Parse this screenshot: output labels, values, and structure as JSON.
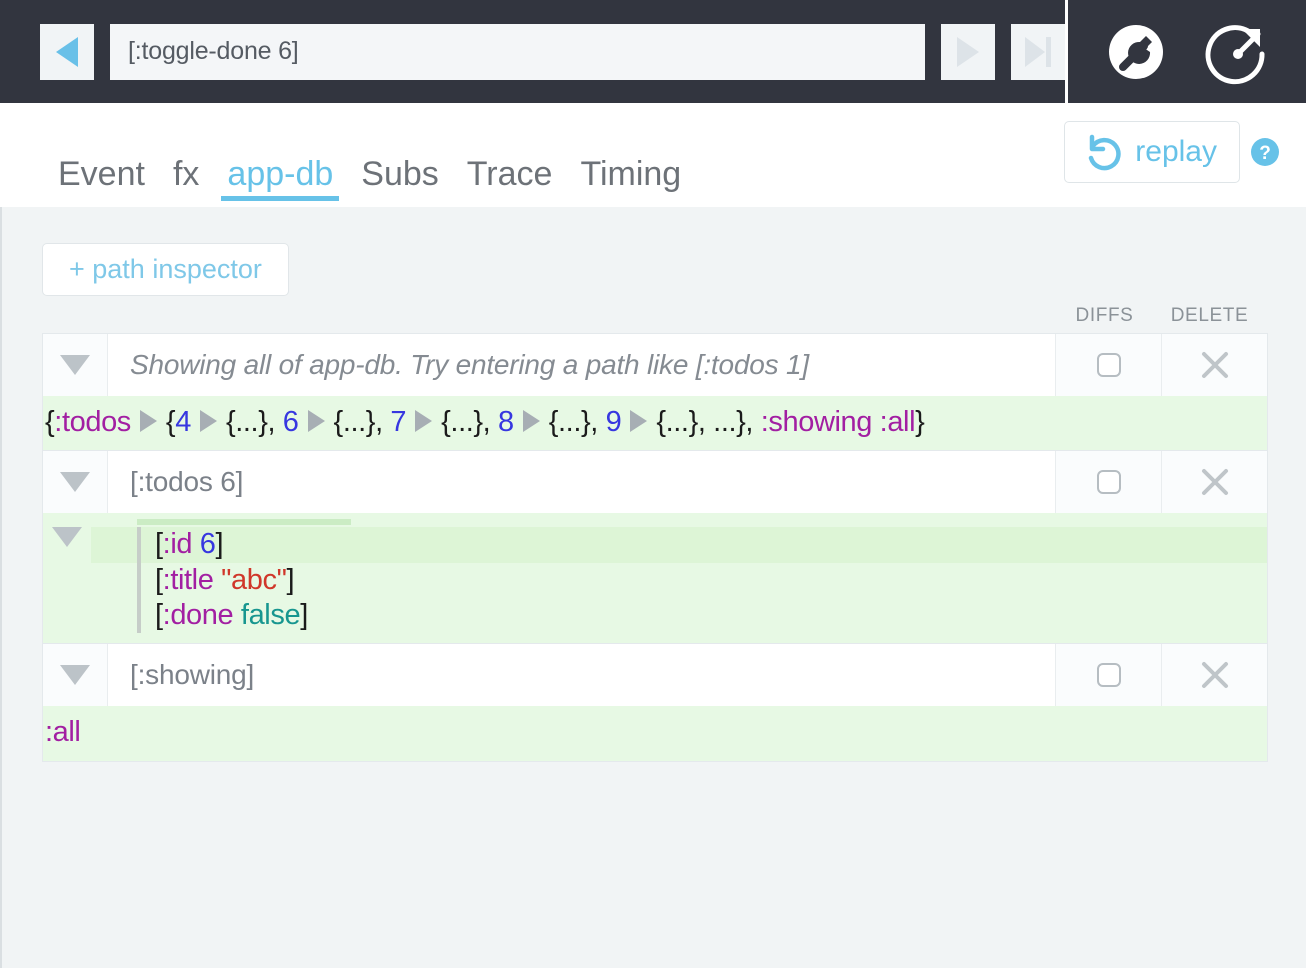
{
  "toolbar": {
    "back_button": "step-back",
    "event_value": "[:toggle-done 6]",
    "event_placeholder": "event",
    "play_button": "play",
    "skip_end_button": "skip-to-end",
    "settings_button": "settings",
    "popout_button": "pop-out"
  },
  "tabs": [
    {
      "label": "Event",
      "active": false
    },
    {
      "label": "fx",
      "active": false
    },
    {
      "label": "app-db",
      "active": true
    },
    {
      "label": "Subs",
      "active": false
    },
    {
      "label": "Trace",
      "active": false
    },
    {
      "label": "Timing",
      "active": false
    }
  ],
  "header": {
    "replay_label": "replay",
    "help_label": "?"
  },
  "main": {
    "add_path_label": "+ path inspector",
    "columns": {
      "diffs": "DIFFS",
      "delete": "DELETE"
    },
    "rows": [
      {
        "path_text": "Showing all of app-db. Try entering a path like [:todos 1]",
        "is_placeholder": true,
        "diffs_checked": false,
        "value_tokens": [
          {
            "t": "punct",
            "v": "{"
          },
          {
            "t": "kw",
            "v": ":todos"
          },
          {
            "t": "expander",
            "v": "▶"
          },
          {
            "t": "punct",
            "v": "{"
          },
          {
            "t": "num",
            "v": "4"
          },
          {
            "t": "expander",
            "v": "▶"
          },
          {
            "t": "punct",
            "v": "{...}, "
          },
          {
            "t": "num",
            "v": "6"
          },
          {
            "t": "expander",
            "v": "▶"
          },
          {
            "t": "punct",
            "v": "{...}, "
          },
          {
            "t": "num",
            "v": "7"
          },
          {
            "t": "expander",
            "v": "▶"
          },
          {
            "t": "punct",
            "v": "{...}, "
          },
          {
            "t": "num",
            "v": "8"
          },
          {
            "t": "expander",
            "v": "▶"
          },
          {
            "t": "punct",
            "v": "{...}, "
          },
          {
            "t": "num",
            "v": "9"
          },
          {
            "t": "expander",
            "v": "▶"
          },
          {
            "t": "punct",
            "v": "{...}, ...}, "
          },
          {
            "t": "kw",
            "v": ":showing :all"
          },
          {
            "t": "punct",
            "v": "}"
          }
        ]
      },
      {
        "path_text": "[:todos 6]",
        "is_placeholder": false,
        "diffs_checked": false,
        "map_lines": [
          {
            "changed": true,
            "tokens": [
              {
                "t": "punct",
                "v": "["
              },
              {
                "t": "kw",
                "v": ":id"
              },
              {
                "t": "punct",
                "v": " "
              },
              {
                "t": "num",
                "v": "6"
              },
              {
                "t": "punct",
                "v": "]"
              }
            ]
          },
          {
            "changed": false,
            "tokens": [
              {
                "t": "punct",
                "v": "["
              },
              {
                "t": "kw",
                "v": ":title"
              },
              {
                "t": "punct",
                "v": " "
              },
              {
                "t": "str",
                "v": "\"abc\""
              },
              {
                "t": "punct",
                "v": "]"
              }
            ]
          },
          {
            "changed": false,
            "tokens": [
              {
                "t": "punct",
                "v": "["
              },
              {
                "t": "kw",
                "v": ":done"
              },
              {
                "t": "punct",
                "v": " "
              },
              {
                "t": "bool",
                "v": "false"
              },
              {
                "t": "punct",
                "v": "]"
              }
            ]
          }
        ]
      },
      {
        "path_text": "[:showing]",
        "is_placeholder": false,
        "diffs_checked": false,
        "value_tokens": [
          {
            "t": "kw",
            "v": ":all"
          }
        ]
      }
    ]
  },
  "colors": {
    "accent": "#67c2e8",
    "toolbar_bg": "#32353f",
    "page_bg": "#f1f4f5",
    "value_bg": "#e7f9e4",
    "keyword": "#a21fa2",
    "number": "#3737e0",
    "string": "#d0372a",
    "boolean": "#17968f"
  }
}
